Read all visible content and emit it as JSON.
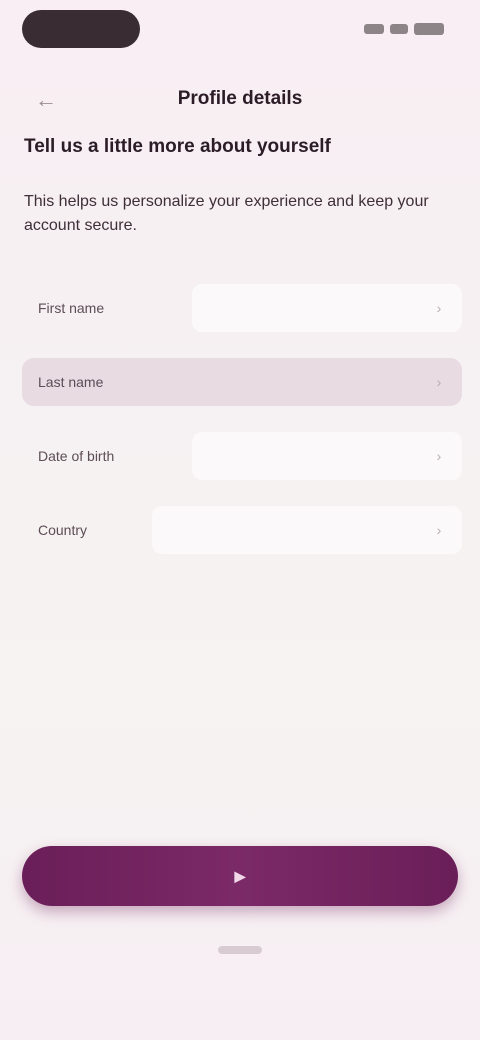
{
  "status_bar": {
    "icons": [
      "signal-icon",
      "wifi-icon",
      "battery-icon"
    ]
  },
  "app_bar": {
    "title": "Profile details",
    "back_icon": "arrow-left-icon"
  },
  "content": {
    "headline": "Tell us a little more about yourself",
    "description": "This helps us personalize your experience and keep your account secure."
  },
  "form": {
    "fields": [
      {
        "label": "First name",
        "value": "",
        "placeholder": ""
      },
      {
        "label": "Last name",
        "value": "",
        "placeholder": ""
      },
      {
        "label": "Date of birth",
        "value": "",
        "placeholder": ""
      },
      {
        "label": "Country",
        "value": "",
        "placeholder": ""
      }
    ]
  },
  "actions": {
    "continue_label": ""
  },
  "colors": {
    "accent": "#6f2260",
    "background": "#f6f1f2",
    "selected_row": "#e8dbe1"
  }
}
